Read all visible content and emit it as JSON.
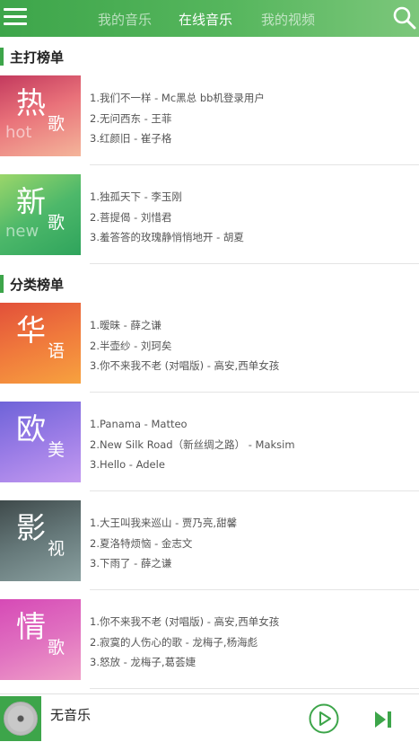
{
  "header": {
    "tabs": [
      {
        "label": "我的音乐",
        "active": false
      },
      {
        "label": "在线音乐",
        "active": true
      },
      {
        "label": "我的视频",
        "active": false
      }
    ],
    "menu_icon": "hamburger-menu-icon",
    "search_icon": "search-icon",
    "accent_color": "#3da54a"
  },
  "sections": [
    {
      "title": "主打榜单"
    },
    {
      "title": "分类榜单"
    }
  ],
  "lists": [
    {
      "cover_big": "热",
      "cover_small": "歌",
      "cover_en": "hot",
      "songs": [
        "1.我们不一样 - Mc黑总 bb机登录用户",
        "2.无问西东 - 王菲",
        "3.红颜旧 - 崔子格"
      ]
    },
    {
      "cover_big": "新",
      "cover_small": "歌",
      "cover_en": "new",
      "songs": [
        "1.独孤天下 - 李玉刚",
        "2.菩提偈 - 刘惜君",
        "3.羞答答的玫瑰静悄悄地开 - 胡夏"
      ]
    },
    {
      "cover_big": "华",
      "cover_small": "语",
      "cover_en": "",
      "songs": [
        "1.暧昧 - 薛之谦",
        "2.半壶纱 - 刘珂矣",
        "3.你不来我不老 (对唱版) - 高安,西单女孩"
      ]
    },
    {
      "cover_big": "欧",
      "cover_small": "美",
      "cover_en": "",
      "songs": [
        "1.Panama - Matteo",
        "2.New Silk Road（新丝绸之路） - Maksim",
        "3.Hello - Adele"
      ]
    },
    {
      "cover_big": "影",
      "cover_small": "视",
      "cover_en": "",
      "songs": [
        "1.大王叫我来巡山 - 贾乃亮,甜馨",
        "2.夏洛特烦恼 - 金志文",
        "3.下雨了 - 薛之谦"
      ]
    },
    {
      "cover_big": "情",
      "cover_small": "歌",
      "cover_en": "",
      "songs": [
        "1.你不来我不老 (对唱版) - 高安,西单女孩",
        "2.寂寞的人伤心的歌 - 龙梅子,杨海彪",
        "3.怒放 - 龙梅子,葛荟婕"
      ]
    }
  ],
  "player": {
    "title": "无音乐",
    "play_icon": "play-circle-icon",
    "next_icon": "skip-next-icon"
  }
}
